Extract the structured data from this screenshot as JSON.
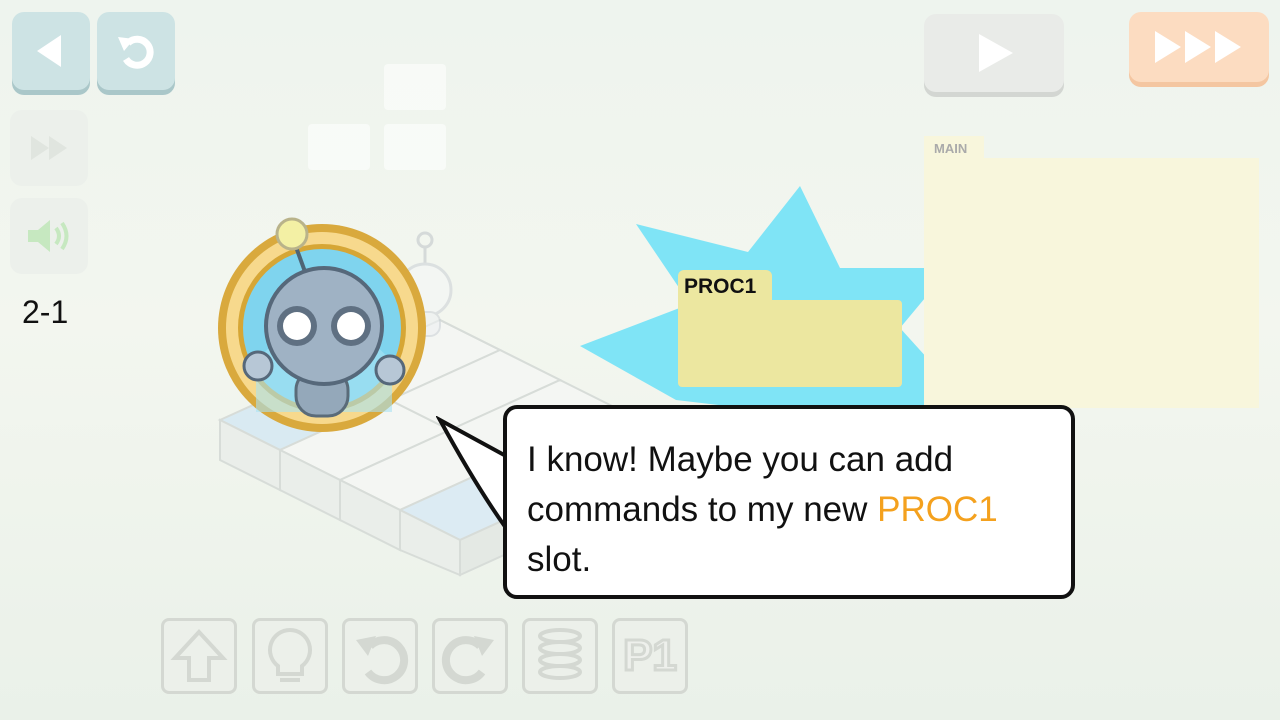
{
  "toolbar": {
    "back_icon": "triangle-left-icon",
    "reset_icon": "undo-icon",
    "play_icon": "play-icon",
    "fast_forward_icon": "triple-arrow-icon",
    "speed_icon": "double-arrow-icon",
    "sound_icon": "speaker-icon"
  },
  "level": {
    "label": "2-1"
  },
  "main_panel": {
    "label": "MAIN"
  },
  "proc_panel": {
    "label": "PROC1"
  },
  "dialog": {
    "text_before": "I know! Maybe you can add commands to my new ",
    "highlight": "PROC1",
    "text_after": " slot."
  },
  "commands": [
    {
      "name": "forward",
      "icon": "arrow-up-icon"
    },
    {
      "name": "light",
      "icon": "bulb-icon"
    },
    {
      "name": "turn-left",
      "icon": "turn-left-icon"
    },
    {
      "name": "turn-right",
      "icon": "turn-right-icon"
    },
    {
      "name": "jump",
      "icon": "spring-icon"
    },
    {
      "name": "proc1",
      "icon": "p1-icon",
      "label": "P1"
    }
  ],
  "colors": {
    "proc_panel": "#ece7a0",
    "main_panel": "#f8f6dc",
    "starburst": "#7fe4f6",
    "highlight": "#f4a11e",
    "fast_forward_btn": "#fcdcc1"
  }
}
